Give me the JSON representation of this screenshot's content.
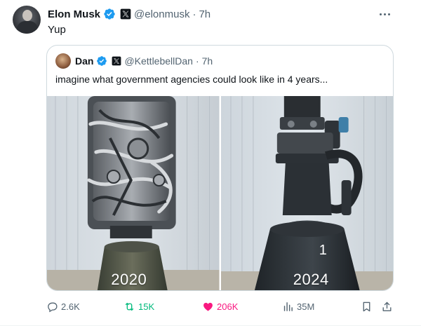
{
  "author": {
    "name": "Elon Musk",
    "handle": "@elonmusk",
    "separator": "·",
    "time": "7h"
  },
  "tweet_text": "Yup",
  "quoted": {
    "name": "Dan",
    "handle": "@KettlebellDan",
    "separator": "·",
    "time": "7h",
    "text": "imagine what government agencies could look like in 4 years...",
    "images": [
      {
        "label": "2020"
      },
      {
        "label": "2024",
        "marker": "1"
      }
    ]
  },
  "actions": {
    "replies": "2.6K",
    "reposts": "15K",
    "likes": "206K",
    "views": "35M"
  },
  "colors": {
    "verified": "#1d9bf0",
    "repost_active": "#00ba7c",
    "like_active": "#f91880",
    "secondary_text": "#536471"
  },
  "icons": {
    "verified": "verified-badge-icon",
    "x": "x-logo-icon",
    "more": "more-icon",
    "reply": "reply-icon",
    "repost": "repost-icon",
    "like": "heart-icon",
    "views": "views-chart-icon",
    "bookmark": "bookmark-icon",
    "share": "share-icon"
  }
}
